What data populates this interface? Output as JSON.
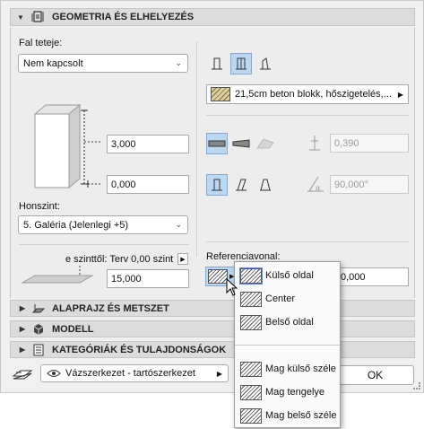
{
  "sections": {
    "geometry": {
      "title": "GEOMETRIA ÉS ELHELYEZÉS",
      "icon": "wall-geometry-icon"
    },
    "floorplan": {
      "title": "ALAPRAJZ ÉS METSZET",
      "icon": "floorplan-section-icon"
    },
    "model": {
      "title": "MODELL",
      "icon": "model-cube-icon"
    },
    "categories": {
      "title": "KATEGÓRIÁK ÉS TULAJDONSÁGOK",
      "icon": "document-list-icon"
    }
  },
  "left": {
    "top_label": "Fal teteje:",
    "top_value": "Nem kapcsolt",
    "height_value": "3,000",
    "offset_value": "0,000",
    "home_story_label": "Honszint:",
    "home_story_value": "5. Galéria (Jelenlegi +5)",
    "story_offset_label": "e szinttől: Terv 0,00 szint",
    "story_offset_value": "15,000"
  },
  "right": {
    "building_material": "21,5cm beton blokk, hőszigetelés,...",
    "thickness_value": "0,390",
    "angle_value": "90,000°",
    "ref_line_label": "Referenciavonal:",
    "ref_offset_value": "0,000"
  },
  "popup": {
    "items": [
      "Külső oldal",
      "Center",
      "Belső oldal",
      "Mag külső széle",
      "Mag tengelye",
      "Mag belső széle"
    ]
  },
  "footer": {
    "layer_value": "Vázszerkezet - tartószerkezet",
    "ok_label": "OK"
  },
  "colors": {
    "selected_toggle": "#bcd7f0",
    "header_bg": "#dcdcdc"
  }
}
